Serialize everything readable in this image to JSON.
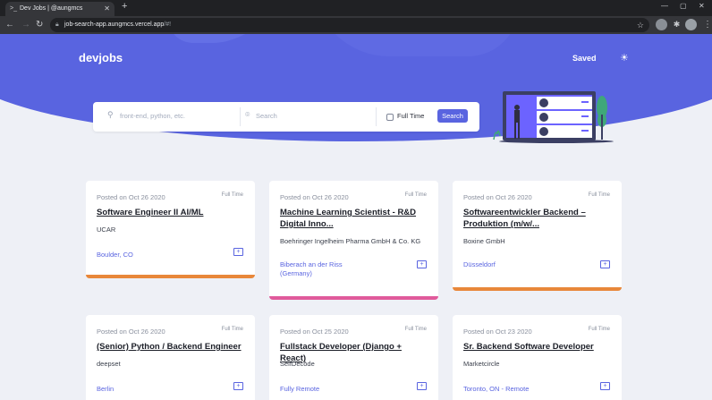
{
  "browser": {
    "tab_title": "Dev Jobs | @aungmcs",
    "url_host": "job-search-app.aungmcs.vercel.app",
    "url_path": "/#!"
  },
  "header": {
    "logo": "devjobs",
    "saved_label": "Saved"
  },
  "search": {
    "keyword_placeholder": "front-end, python, etc.",
    "location_placeholder": "Search",
    "fulltime_label": "Full Time",
    "button_label": "Search"
  },
  "jobs": [
    {
      "posted": "Posted on Oct 26 2020",
      "type": "Full Time",
      "title": "Software Engineer II AI/ML",
      "company": "UCAR",
      "location": "Boulder, CO",
      "accent": "#e8873a"
    },
    {
      "posted": "Posted on Oct 26 2020",
      "type": "Full Time",
      "title": "Machine Learning Scientist - R&D Digital Inno...",
      "company": "Boehringer Ingelheim Pharma GmbH & Co. KG",
      "location": "Biberach an der Riss (Germany)",
      "accent": "#e05a9b"
    },
    {
      "posted": "Posted on Oct 26 2020",
      "type": "Full Time",
      "title": "Softwareentwickler Backend – Produktion (m/w/...",
      "company": "Boxine GmbH",
      "location": "Düsseldorf",
      "accent": "#e8873a"
    },
    {
      "posted": "Posted on Oct 26 2020",
      "type": "Full Time",
      "title": "(Senior) Python / Backend Engineer",
      "company": "deepset",
      "location": "Berlin",
      "accent": "#e8873a"
    },
    {
      "posted": "Posted on Oct 25 2020",
      "type": "Full Time",
      "title": "Fullstack Developer (Django + React)",
      "company": "SelfDecode",
      "location": "Fully Remote",
      "accent": "#e8873a"
    },
    {
      "posted": "Posted on Oct 23 2020",
      "type": "Full Time",
      "title": "Sr. Backend Software Developer",
      "company": "Marketcircle",
      "location": "Toronto, ON - Remote",
      "accent": "#e8873a"
    }
  ],
  "colors": {
    "brand": "#5964e0",
    "background": "#eef0f6"
  }
}
